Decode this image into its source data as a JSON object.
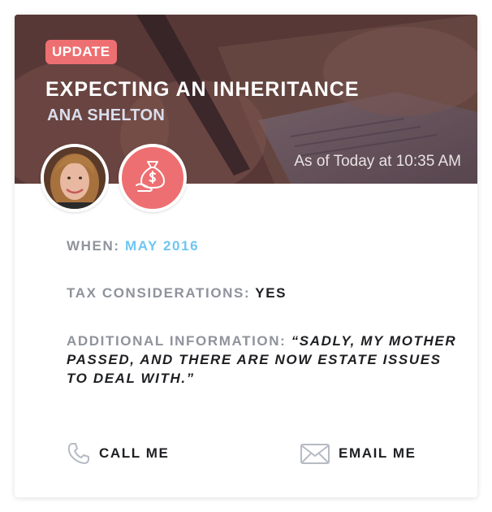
{
  "card": {
    "badge": "UPDATE",
    "title": "EXPECTING AN INHERITANCE",
    "client_name": "ANA SHELTON",
    "timestamp": "As of Today at 10:35 AM",
    "category_icon": "money-bag-icon",
    "accent_color": "#ee6f71"
  },
  "details": {
    "when_label": "WHEN:",
    "when_value": "MAY 2016",
    "tax_label": "TAX CONSIDERATIONS:",
    "tax_value": "YES",
    "info_label": "ADDITIONAL INFORMATION:",
    "info_value": "“SADLY, MY MOTHER PASSED, AND THERE ARE NOW ESTATE ISSUES TO DEAL WITH.”"
  },
  "actions": {
    "call_label": "CALL ME",
    "call_icon": "phone-icon",
    "email_label": "EMAIL ME",
    "email_icon": "envelope-icon"
  }
}
